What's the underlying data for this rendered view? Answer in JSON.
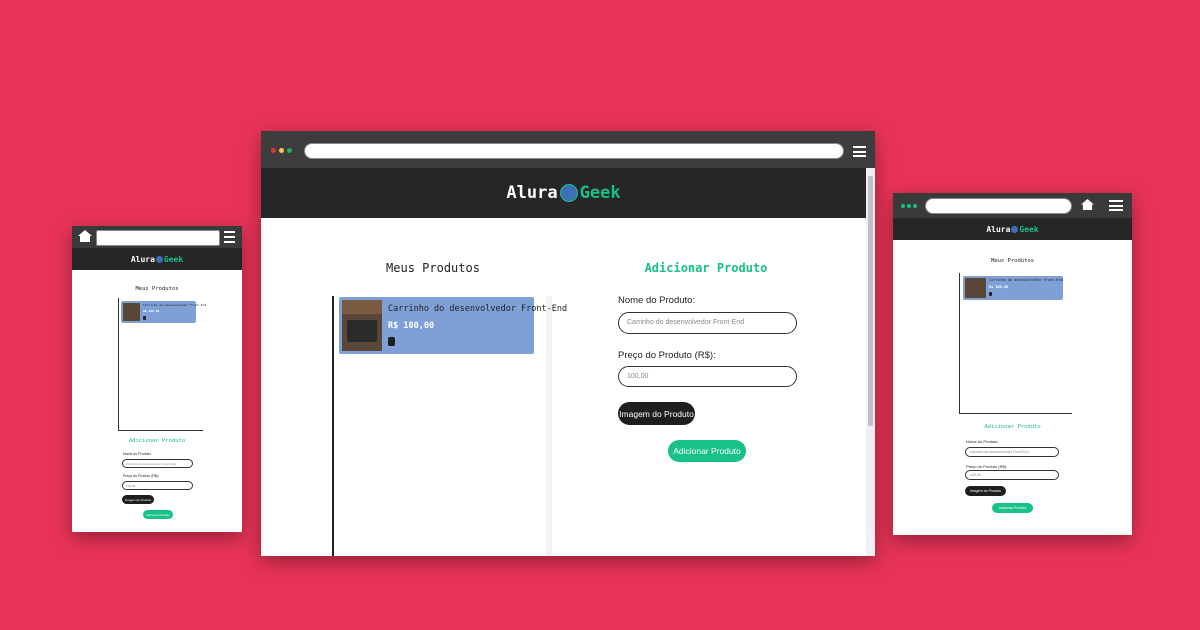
{
  "logo": {
    "left": "Alura",
    "right": "Geek"
  },
  "products_title": "Meus Produtos",
  "form_title": "Adicionar Produto",
  "product": {
    "name": "Carrinho do desenvolvedor Front-End",
    "price": "R$ 100,00"
  },
  "form": {
    "name_label": "Nome do Produto:",
    "name_placeholder": "Carrinho do desenvolvedor Front-End",
    "price_label": "Preço do Produto (R$):",
    "price_placeholder": "100,00",
    "image_button": "Imagem do Produto",
    "submit_button": "Adicionar Produto"
  },
  "colors": {
    "background": "#e83357",
    "header": "#262626",
    "accent": "#18c08a",
    "card": "#7ea0d6"
  },
  "icons": {
    "home": "home-icon",
    "menu": "hamburger-menu-icon",
    "trash": "trash-icon"
  }
}
